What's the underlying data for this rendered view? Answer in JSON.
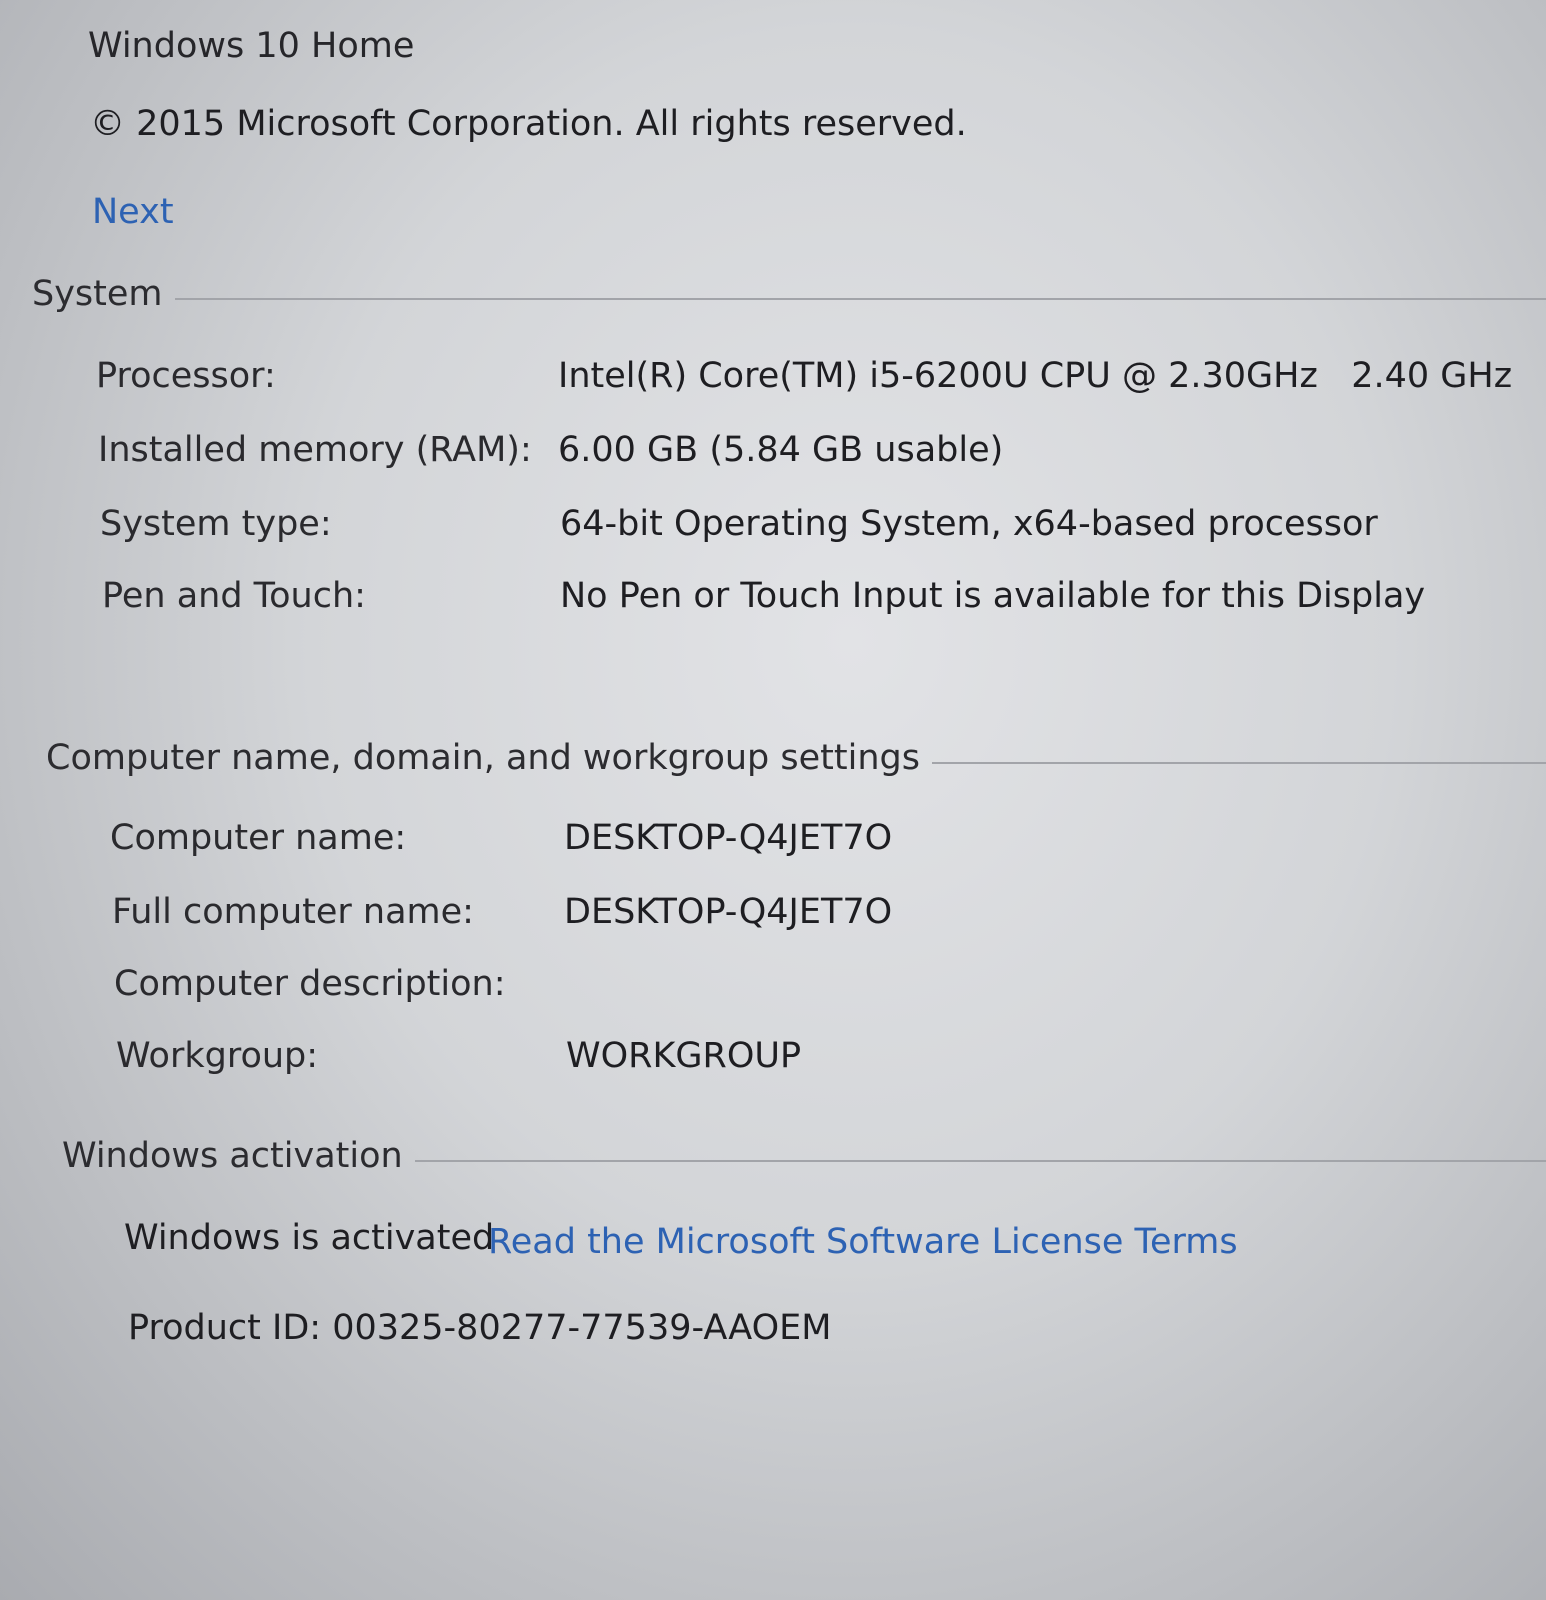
{
  "edition": {
    "name": "Windows 10 Home",
    "copyright": "© 2015 Microsoft Corporation. All rights reserved.",
    "next_label": "Next"
  },
  "system": {
    "title": "System",
    "rows": [
      {
        "label": "Processor:",
        "value": "Intel(R) Core(TM) i5-6200U CPU @ 2.30GHz   2.40 GHz"
      },
      {
        "label": "Installed memory (RAM):",
        "value": "6.00 GB (5.84 GB usable)"
      },
      {
        "label": "System type:",
        "value": "64-bit Operating System, x64-based processor"
      },
      {
        "label": "Pen and Touch:",
        "value": "No Pen or Touch Input is available for this Display"
      }
    ]
  },
  "computer_name": {
    "title": "Computer name, domain, and workgroup settings",
    "rows": [
      {
        "label": "Computer name:",
        "value": "DESKTOP-Q4JET7O"
      },
      {
        "label": "Full computer name:",
        "value": "DESKTOP-Q4JET7O"
      },
      {
        "label": "Computer description:",
        "value": ""
      },
      {
        "label": "Workgroup:",
        "value": "WORKGROUP"
      }
    ]
  },
  "activation": {
    "title": "Windows activation",
    "status": "Windows is activated",
    "license_link": "Read the Microsoft Software License Terms",
    "product_id": "Product ID: 00325-80277-77539-AAOEM"
  },
  "colors": {
    "link": "#2d62b3",
    "text": "#1e1e22",
    "rule": "#a2a4a9"
  }
}
